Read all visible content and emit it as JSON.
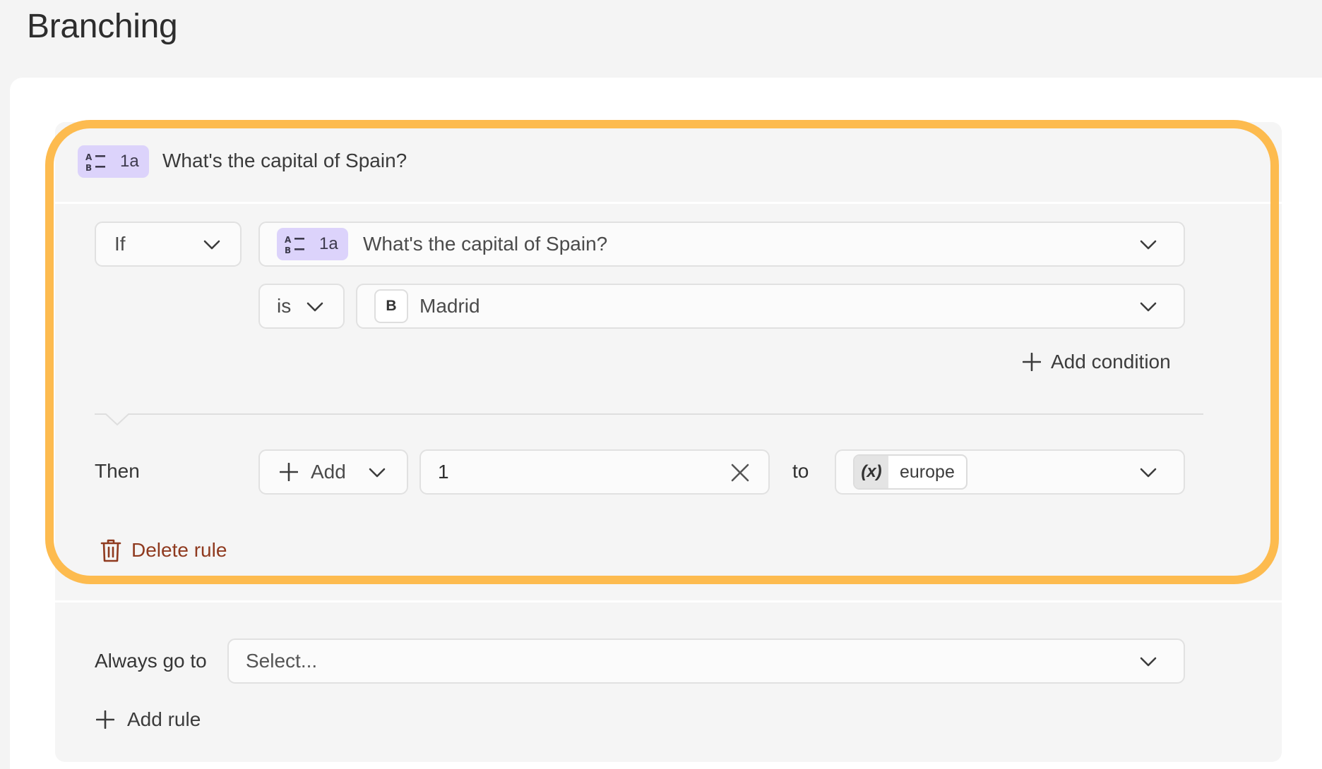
{
  "page": {
    "title": "Branching"
  },
  "rule": {
    "question": {
      "badge": "1a",
      "text": "What's the capital of Spain?"
    },
    "condition": {
      "operator_label": "If",
      "question_badge": "1a",
      "question_text": "What's the capital of Spain?",
      "comparator": "is",
      "answer_key": "B",
      "answer_text": "Madrid"
    },
    "add_condition_label": "Add condition",
    "then": {
      "label": "Then",
      "action_label": "Add",
      "value": "1",
      "to_label": "to",
      "variable_icon": "(x)",
      "variable_name": "europe"
    },
    "delete_label": "Delete rule"
  },
  "always": {
    "label": "Always go to",
    "placeholder": "Select..."
  },
  "add_rule_label": "Add rule",
  "colors": {
    "highlight": "#fdbb4f",
    "badge": "#dcd3fb",
    "delete": "#8f3a1f"
  },
  "icons": [
    "ab-choice-icon",
    "chevron-down-icon",
    "plus-icon",
    "clear-x-icon",
    "trash-icon",
    "variable-icon"
  ]
}
